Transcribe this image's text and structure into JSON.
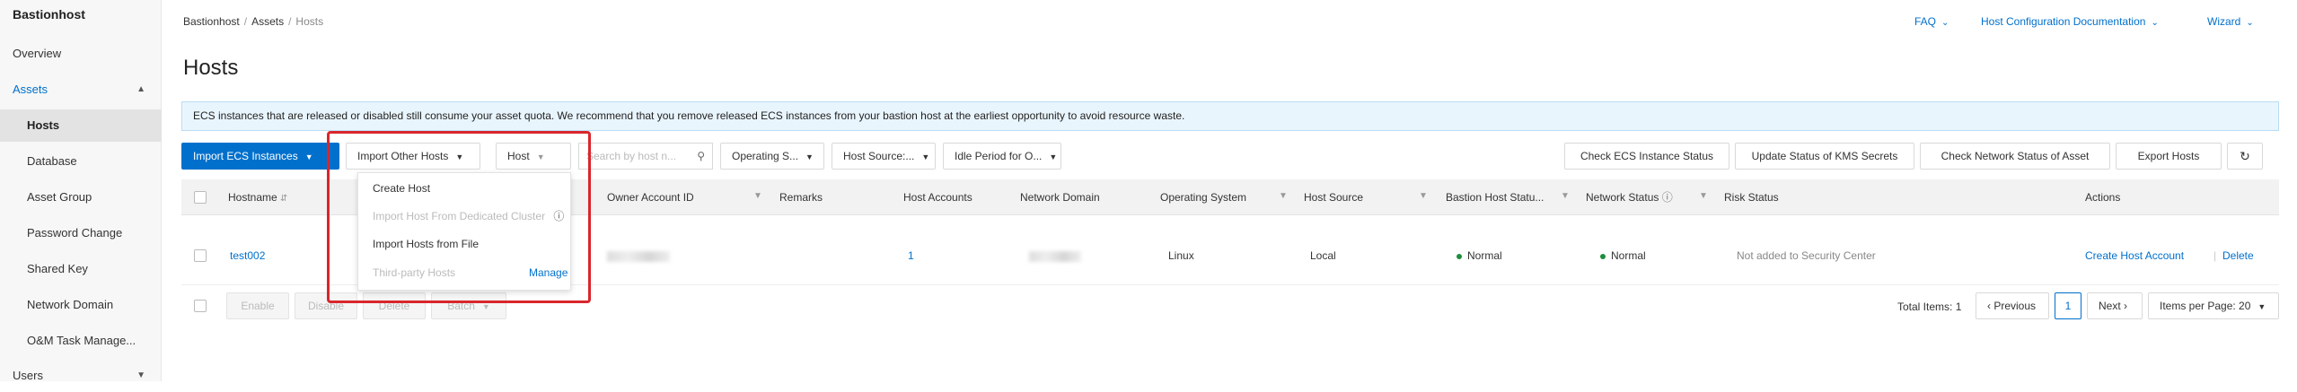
{
  "sidebar": {
    "brand": "Bastionhost",
    "items": [
      {
        "label": "Overview"
      },
      {
        "label": "Assets"
      },
      {
        "label": "Hosts"
      },
      {
        "label": "Database"
      },
      {
        "label": "Asset Group"
      },
      {
        "label": "Password Change"
      },
      {
        "label": "Shared Key"
      },
      {
        "label": "Network Domain"
      },
      {
        "label": "O&M Task Manage..."
      },
      {
        "label": "Users"
      }
    ]
  },
  "header": {
    "breadcrumb": [
      "Bastionhost",
      "Assets",
      "Hosts"
    ],
    "links": [
      "FAQ",
      "Host Configuration Documentation",
      "Wizard"
    ]
  },
  "page": {
    "title": "Hosts",
    "notice": "ECS instances that are released or disabled still consume your asset quota. We recommend that you remove released ECS instances from your bastion host at the earliest opportunity to avoid resource waste."
  },
  "toolbar": {
    "import_ecs": "Import ECS Instances",
    "import_other": "Import Other Hosts",
    "host_select": "Host",
    "search_placeholder": "Search by host n...",
    "os_filter": "Operating S...",
    "host_source_filter": "Host Source:...",
    "idle_filter": "Idle Period for O...",
    "check_ecs": "Check ECS Instance Status",
    "update_kms": "Update Status of KMS Secrets",
    "check_network": "Check Network Status of Asset",
    "export": "Export Hosts"
  },
  "dropdown": {
    "create_host": "Create Host",
    "import_dedicated": "Import Host From Dedicated Cluster",
    "import_file": "Import Hosts from File",
    "third_party": "Third-party Hosts",
    "manage": "Manage"
  },
  "table": {
    "headers": {
      "hostname": "Hostname",
      "owner": "Owner Account ID",
      "remarks": "Remarks",
      "host_accounts": "Host Accounts",
      "network_domain": "Network Domain",
      "os": "Operating System",
      "host_source": "Host Source",
      "bastion_status": "Bastion Host Statu...",
      "network_status": "Network Status",
      "risk_status": "Risk Status",
      "actions": "Actions"
    },
    "rows": [
      {
        "hostname": "test002",
        "host_accounts": "1",
        "os": "Linux",
        "host_source": "Local",
        "bastion_status": "Normal",
        "network_status": "Normal",
        "risk_status": "Not added to Security Center",
        "action_create": "Create Host Account",
        "action_delete": "Delete"
      }
    ]
  },
  "bulk": {
    "enable": "Enable",
    "disable": "Disable",
    "delete": "Delete",
    "batch": "Batch"
  },
  "pagination": {
    "total": "Total Items: 1",
    "previous": "Previous",
    "page": "1",
    "next": "Next",
    "per_page": "Items per Page: 20"
  },
  "colors": {
    "accent": "#0070cc",
    "highlight": "#d9262c",
    "status_ok": "#1e8e3e"
  }
}
